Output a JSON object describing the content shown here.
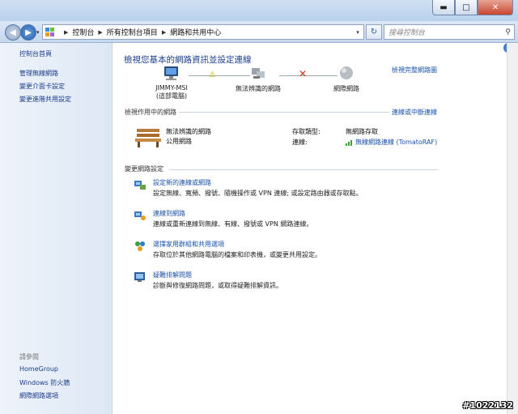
{
  "window": {
    "minimize": "▬",
    "maximize": "□",
    "close": "✕"
  },
  "address": {
    "back": "◀",
    "forward": "▶",
    "dropdown": "▾",
    "crumbs": [
      "控制台",
      "所有控制台項目",
      "網路和共用中心"
    ],
    "refresh": "↻",
    "search_placeholder": "搜尋控制台",
    "search_icon": "⚲"
  },
  "sidebar": {
    "home": "控制台首頁",
    "links": [
      "管理無線網路",
      "變更介面卡設定",
      "變更進階共用設定"
    ],
    "see_also_heading": "請參閱",
    "see_also": [
      "HomeGroup",
      "Windows 防火牆",
      "網際網路選項"
    ]
  },
  "main": {
    "title": "檢視您基本的網路資訊並設定連線",
    "full_map_link": "檢視完整網路圖",
    "nodes": [
      {
        "label": "JIMMY-MSI",
        "sub": "(這部電腦)"
      },
      {
        "label": "無法辨識的網路",
        "sub": ""
      },
      {
        "label": "網際網路",
        "sub": ""
      }
    ],
    "active_heading": "檢視作用中的網路",
    "connect_link": "連線或中斷連線",
    "network": {
      "name": "無法辨識的網路",
      "type": "公用網路",
      "access_label": "存取類型:",
      "access_value": "無網路存取",
      "conn_label": "連線:",
      "conn_value": "無線網路連線 (TomatoRAF)"
    },
    "change_heading": "變更網路設定",
    "tasks": [
      {
        "icon": "setup-connection-icon",
        "link": "設定新的連線或網路",
        "desc": "設定無線、寬頻、撥號、隨機操作或 VPN 連線; 或設定路由器或存取點。"
      },
      {
        "icon": "connect-network-icon",
        "link": "連線到網路",
        "desc": "連線或重新連線到無線、有線、撥號或 VPN 網路連線。"
      },
      {
        "icon": "homegroup-icon",
        "link": "選擇家用群組和共用選項",
        "desc": "存取位於其他網路電腦的檔案和印表機，或變更共用設定。"
      },
      {
        "icon": "troubleshoot-icon",
        "link": "疑難排解問題",
        "desc": "診斷與修復網路問題，或取得疑難排解資訊。"
      }
    ]
  },
  "help_label": "?",
  "watermark": "#1022132",
  "colors": {
    "link": "#1a52a8",
    "title": "#1b3f8c",
    "warning": "#d6a400",
    "error": "#d52a1c"
  }
}
